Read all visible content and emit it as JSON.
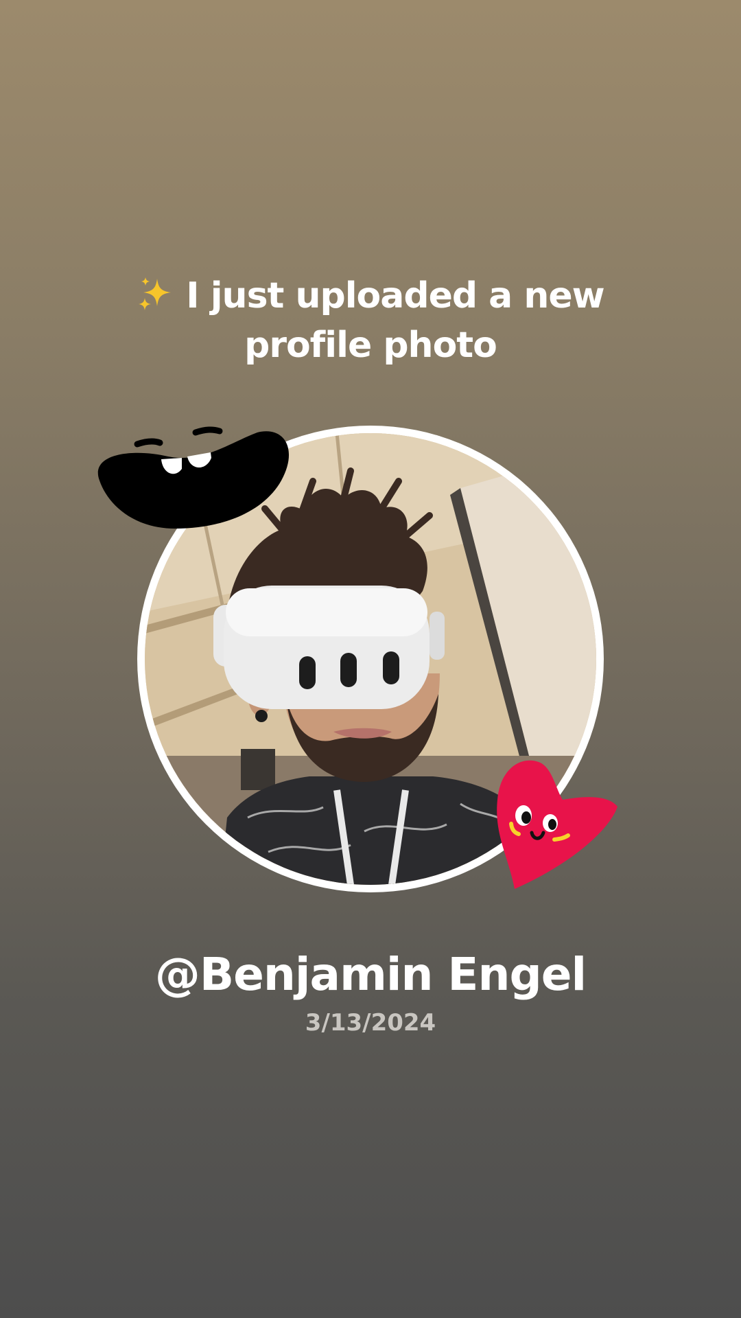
{
  "caption": {
    "text": "I just uploaded a new profile photo",
    "emoji_icon": "sparkles-icon"
  },
  "profile": {
    "handle": "@Benjamin Engel",
    "date": "3/13/2024"
  },
  "stickers": [
    "smiling-mouth-sticker",
    "heart-face-sticker"
  ],
  "colors": {
    "bg_top": "#9c8a6c",
    "bg_bottom": "#4d4d4d",
    "frame": "#ffffff",
    "heart": "#e8134a",
    "sparkle": "#f7c52b"
  }
}
